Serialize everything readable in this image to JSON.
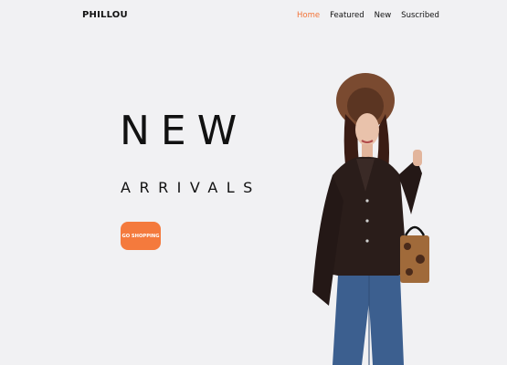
{
  "header": {
    "logo": "PHILLOU",
    "nav": [
      {
        "label": "Home",
        "active": true
      },
      {
        "label": "Featured",
        "active": false
      },
      {
        "label": "New",
        "active": false
      },
      {
        "label": "Suscribed",
        "active": false
      }
    ]
  },
  "hero": {
    "title": "NEW",
    "subtitle": "ARRIVALS",
    "cta_label": "GO SHOPPING"
  },
  "colors": {
    "background": "#f1f1f3",
    "accent": "#f47a3d",
    "text": "#111111"
  },
  "image": {
    "description_icon": "fashion-model-photo"
  }
}
